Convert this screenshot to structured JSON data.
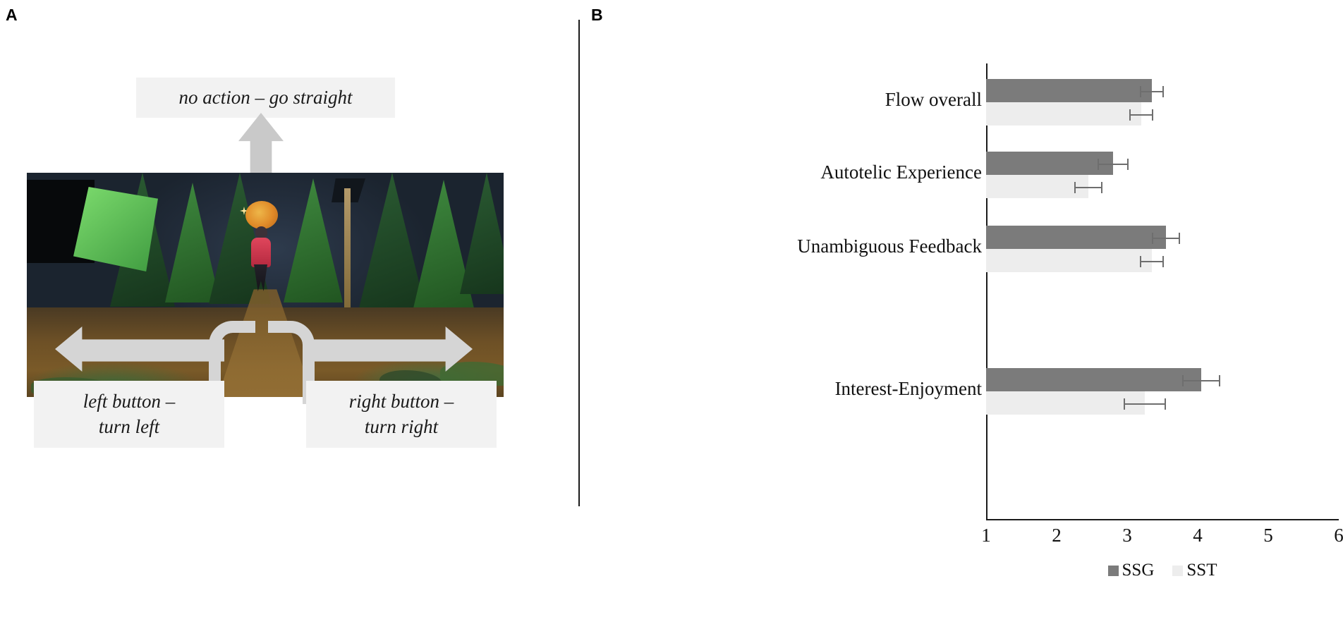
{
  "panels": {
    "a": {
      "letter": "A"
    },
    "b": {
      "letter": "B"
    }
  },
  "game_panel": {
    "callouts": {
      "straight": "no action – go straight",
      "left": "left button –\nturn left",
      "right": "right button –\nturn right"
    },
    "arrows": {
      "up": "arrow-up-icon",
      "left": "arrow-left-icon",
      "right": "arrow-right-icon"
    }
  },
  "chart_data": {
    "type": "bar",
    "orientation": "horizontal",
    "title": "",
    "xlabel": "",
    "ylabel": "",
    "xlim": [
      1,
      6
    ],
    "tick_labels": [
      "1",
      "2",
      "3",
      "4",
      "5",
      "6"
    ],
    "grid": false,
    "legend_position": "bottom-center",
    "categories": [
      "Flow overall",
      "Autotelic Experience",
      "Unambiguous Feedback",
      "Interest-Enjoyment"
    ],
    "series": [
      {
        "name": "SSG",
        "color": "#7b7b7b",
        "values": [
          3.35,
          2.8,
          3.55,
          4.05
        ],
        "errors": [
          0.17,
          0.22,
          0.2,
          0.27
        ]
      },
      {
        "name": "SST",
        "color": "#ededed",
        "values": [
          3.2,
          2.45,
          3.35,
          3.25
        ],
        "errors": [
          0.17,
          0.2,
          0.17,
          0.3
        ]
      }
    ],
    "legend": [
      {
        "label": "SSG",
        "color": "#7b7b7b"
      },
      {
        "label": "SST",
        "color": "#ededed"
      }
    ]
  }
}
